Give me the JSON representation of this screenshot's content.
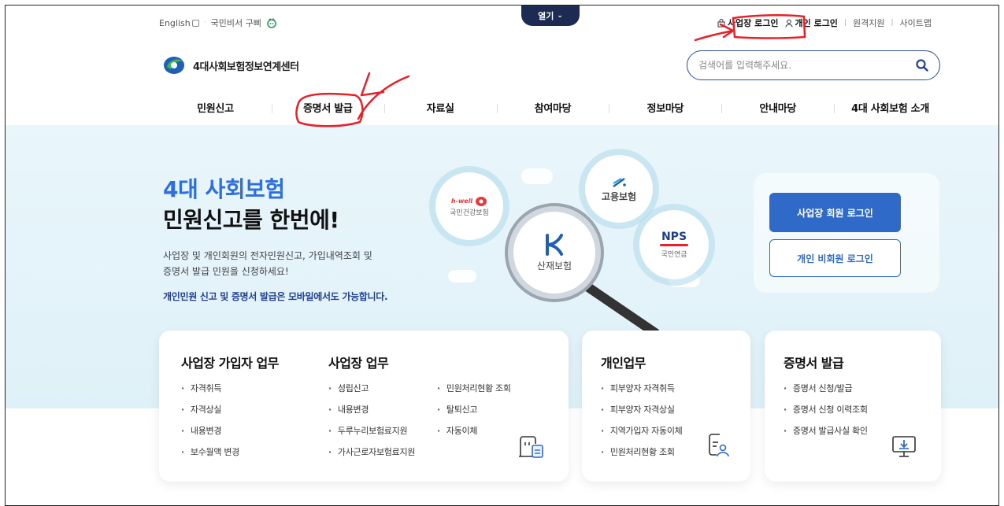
{
  "util": {
    "english": "English",
    "secretary": "국민비서 구삐",
    "open_tab": "열기",
    "biz_login": "사업장 로그인",
    "personal_login": "개인 로그인",
    "remote": "원격지원",
    "sitemap": "사이트맵"
  },
  "logo": {
    "text": "4대사회보험정보연계센터"
  },
  "search": {
    "placeholder": "검색어를 입력해주세요."
  },
  "nav": {
    "items": [
      "민원신고",
      "증명서 발급",
      "자료실",
      "참여마당",
      "정보마당",
      "안내마당",
      "4대 사회보험 소개"
    ]
  },
  "hero": {
    "title_line1": "4대 사회보험",
    "title_line2": "민원신고를 한번에!",
    "desc": "사업장 및 개인회원의 전자민원신고, 가입내역조회 및\n증명서 발급 민원을 신청하세요!",
    "mobile_note": "개인민원 신고 및 증명서 발급은 모바일에서도 가능합니다.",
    "bubbles": {
      "health_brand": "h-well",
      "health": "국민건강보험",
      "employ": "고용보험",
      "accident": "산재보험",
      "nps_brand": "NPS",
      "nps": "국민연금"
    }
  },
  "login": {
    "biz_member": "사업장 회원 로그인",
    "personal_nonmember": "개인 비회원 로그인"
  },
  "cards": {
    "biz_member": {
      "title": "사업장 가입자 업무",
      "items": [
        "자격취득",
        "자격상실",
        "내용변경",
        "보수월액 변경"
      ]
    },
    "biz": {
      "title": "사업장 업무",
      "col1": [
        "성립신고",
        "내용변경",
        "두루누리보험료지원",
        "가사근로자보험료지원"
      ],
      "col2": [
        "민원처리현황 조회",
        "탈퇴신고",
        "자동이체"
      ]
    },
    "personal": {
      "title": "개인업무",
      "items": [
        "피부양자 자격취득",
        "피부양자 자격상실",
        "지역가입자 자동이체",
        "민원처리현황 조회"
      ]
    },
    "cert": {
      "title": "증명서 발급",
      "items": [
        "증명서 신청/발급",
        "증명서 신청 이력조회",
        "증명서 발급사실 확인"
      ]
    }
  },
  "colors": {
    "primary": "#2f6ac9",
    "hero_blue": "#2d6ee0",
    "navy": "#1d2b52",
    "annotation": "#e8202a"
  }
}
